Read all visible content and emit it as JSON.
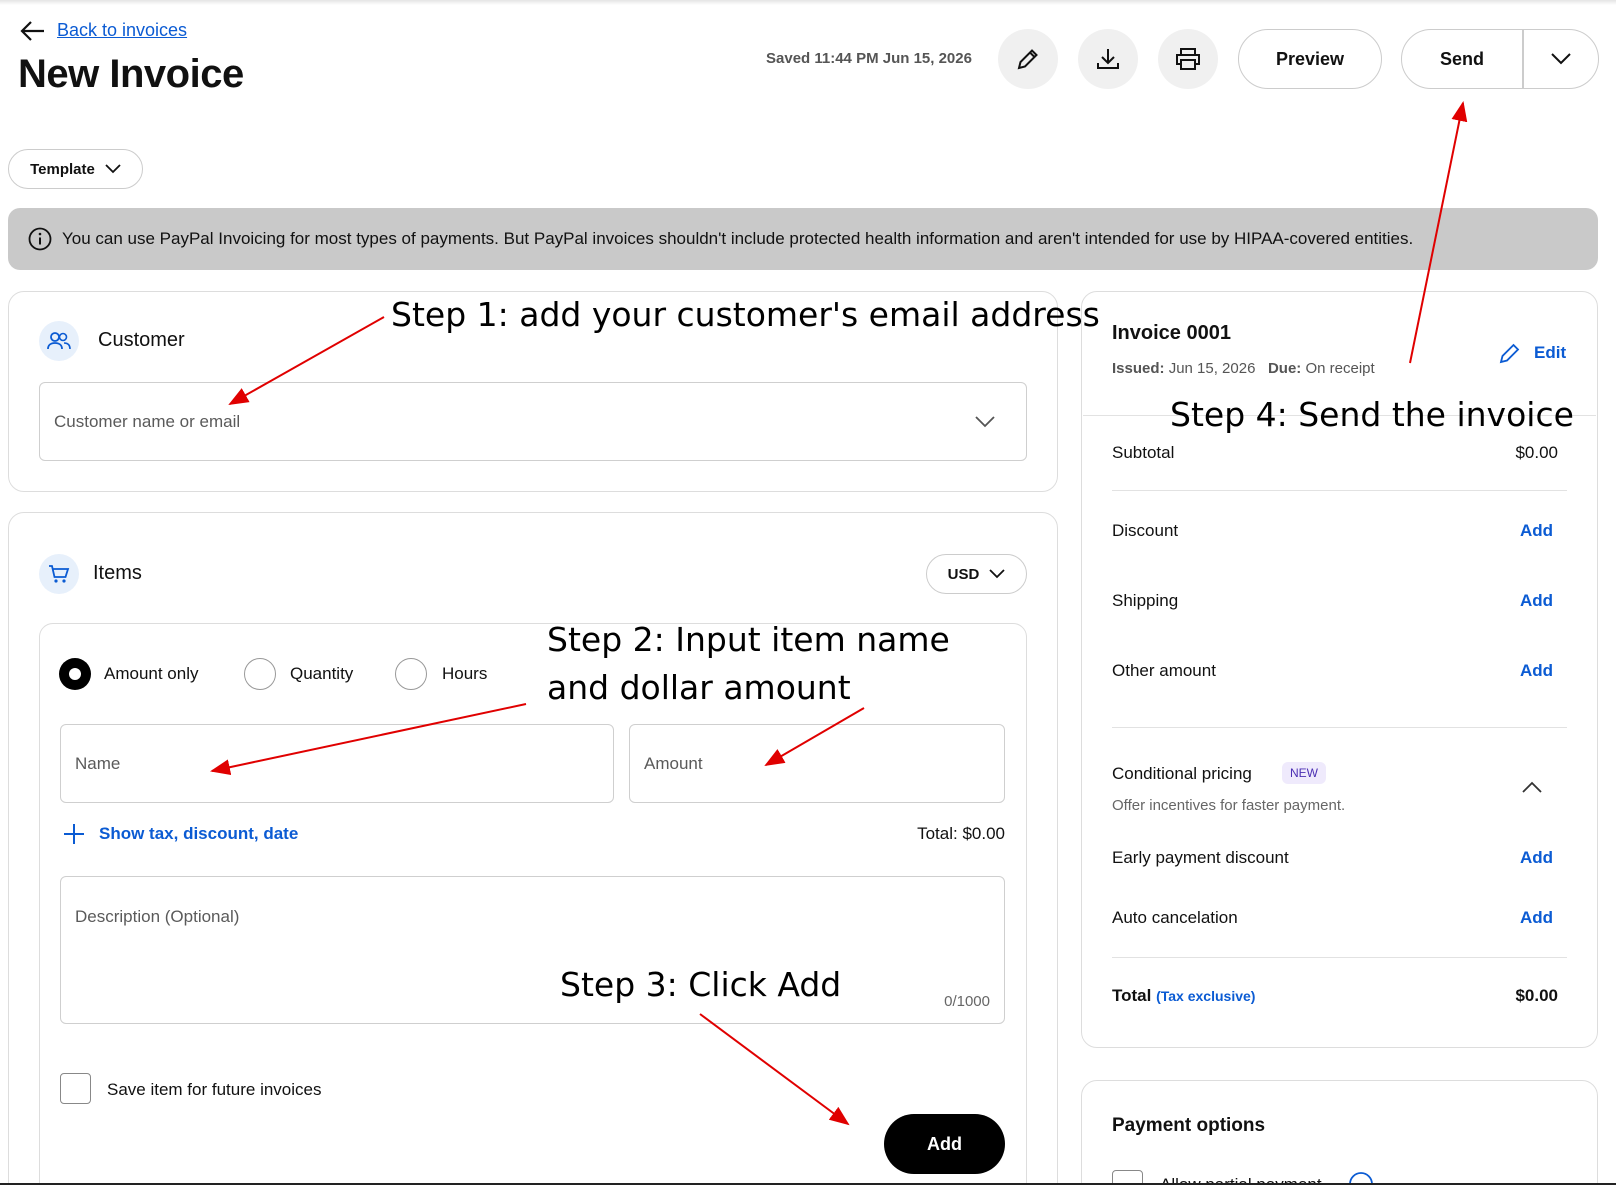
{
  "header": {
    "back_link": "Back to invoices",
    "title": "New Invoice",
    "saved_status": "Saved 11:44 PM Jun 15, 2026",
    "preview_label": "Preview",
    "send_label": "Send"
  },
  "template_label": "Template",
  "banner_text": "You can use PayPal Invoicing for most types of payments. But PayPal invoices shouldn't include protected health information and aren't intended for use by HIPAA-covered entities.",
  "customer": {
    "title": "Customer",
    "placeholder": "Customer name or email"
  },
  "items": {
    "title": "Items",
    "currency": "USD",
    "modes": [
      "Amount only",
      "Quantity",
      "Hours"
    ],
    "selected_mode": "Amount only",
    "name_placeholder": "Name",
    "amount_placeholder": "Amount",
    "show_more_label": "Show tax, discount, date",
    "total_label": "Total: $0.00",
    "description_placeholder": "Description (Optional)",
    "char_count": "0/1000",
    "save_item_label": "Save item for future invoices",
    "save_item_checked": false,
    "add_button": "Add"
  },
  "summary": {
    "invoice_number": "Invoice 0001",
    "issued_label": "Issued:",
    "issued_value": "Jun 15, 2026",
    "due_label": "Due:",
    "due_value": "On receipt",
    "edit_label": "Edit",
    "subtotal_label": "Subtotal",
    "subtotal_value": "$0.00",
    "rows": [
      {
        "label": "Discount",
        "action": "Add"
      },
      {
        "label": "Shipping",
        "action": "Add"
      },
      {
        "label": "Other amount",
        "action": "Add"
      }
    ],
    "conditional": {
      "title": "Conditional pricing",
      "badge": "NEW",
      "subtitle": "Offer incentives for faster payment.",
      "rows": [
        {
          "label": "Early payment discount",
          "action": "Add"
        },
        {
          "label": "Auto cancelation",
          "action": "Add"
        }
      ]
    },
    "total_label": "Total",
    "tax_note": "(Tax exclusive)",
    "total_value": "$0.00"
  },
  "payment_options": {
    "title": "Payment options",
    "partial_label": "Allow partial payment"
  },
  "annotations": {
    "step1": "Step 1: add your customer's email address",
    "step2_line1": "Step 2: Input item name",
    "step2_line2": "and dollar amount",
    "step3": "Step 3: Click Add",
    "step4": "Step 4: Send the invoice"
  },
  "colors": {
    "link_blue": "#0b5bd3",
    "annotation_arrow": "#e00000",
    "banner_gray": "#c9c9c9"
  }
}
